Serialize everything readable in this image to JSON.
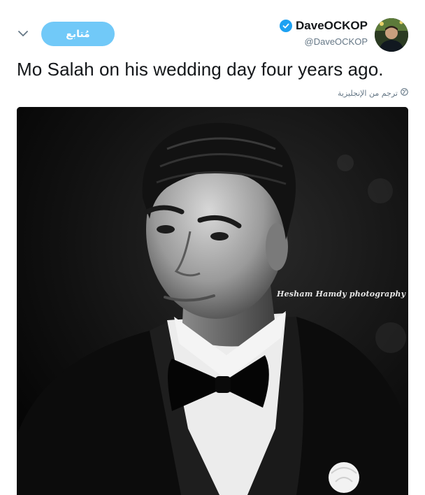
{
  "header": {
    "follow_label": "مُتابع",
    "display_name": "DaveOCKOP",
    "handle": "@DaveOCKOP",
    "verified": true
  },
  "tweet": {
    "text": "Mo Salah on his wedding day four years ago.",
    "translate_label": "ترجم من الإنجليزية"
  },
  "media": {
    "watermark": "Hesham Hamdy photography"
  },
  "icons": {
    "chevron": "chevron-down-icon",
    "verified": "verified-badge-icon",
    "globe": "globe-icon"
  },
  "colors": {
    "follow_button": "#71c9f8",
    "verified": "#1da1f2",
    "secondary_text": "#657786",
    "primary_text": "#14171a"
  }
}
